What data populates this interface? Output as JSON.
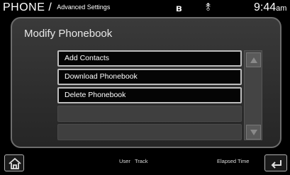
{
  "status": {
    "screen": "PHONE",
    "separator": "/",
    "submenu": "Advanced Settings",
    "bluetooth_icon": "bluetooth-icon",
    "usb_icon": "usb-icon",
    "time": "9:44",
    "ampm": "am"
  },
  "title": "Modify Phonebook",
  "menu": {
    "items": [
      {
        "label": "Add Contacts"
      },
      {
        "label": "Download Phonebook"
      },
      {
        "label": "Delete Phonebook"
      }
    ],
    "empty_slots": 2
  },
  "footer": {
    "home_icon": "home-icon",
    "user_label": "User",
    "track_label": "Track",
    "elapsed_label": "Elapsed Time",
    "back_icon": "back-icon"
  }
}
